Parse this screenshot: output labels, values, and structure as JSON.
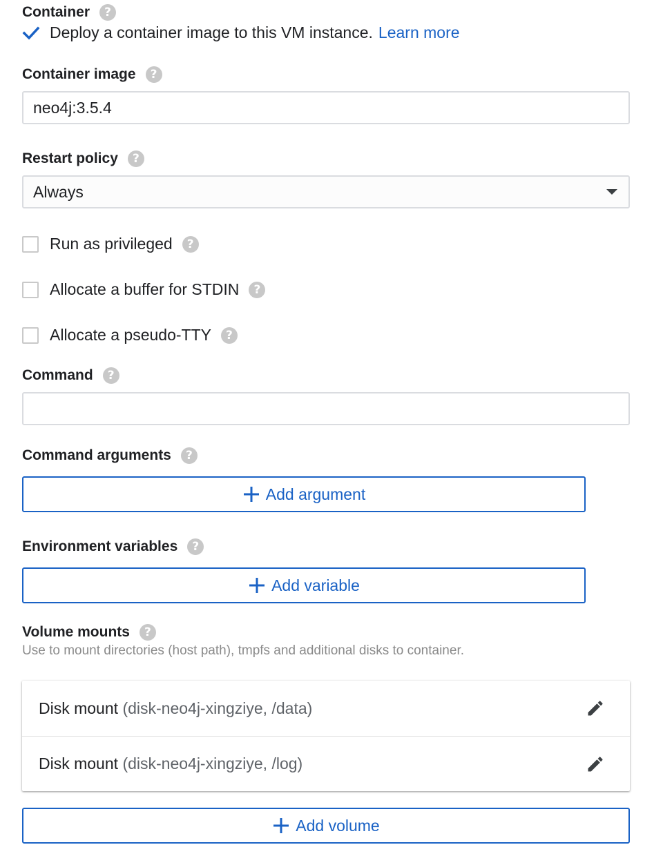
{
  "container": {
    "label": "Container",
    "deploy_checked": true,
    "deploy_text": "Deploy a container image to this VM instance.",
    "learn_more": "Learn more"
  },
  "container_image": {
    "label": "Container image",
    "value": "neo4j:3.5.4"
  },
  "restart_policy": {
    "label": "Restart policy",
    "selected": "Always"
  },
  "options": {
    "privileged": "Run as privileged",
    "stdin": "Allocate a buffer for STDIN",
    "tty": "Allocate a pseudo-TTY"
  },
  "command": {
    "label": "Command",
    "value": ""
  },
  "command_arguments": {
    "label": "Command arguments",
    "button": "Add argument"
  },
  "env_vars": {
    "label": "Environment variables",
    "button": "Add variable"
  },
  "volume_mounts": {
    "label": "Volume mounts",
    "description": "Use to mount directories (host path), tmpfs and additional disks to container.",
    "items": [
      {
        "type": "Disk mount",
        "detail": "(disk-neo4j-xingziye, /data)"
      },
      {
        "type": "Disk mount",
        "detail": "(disk-neo4j-xingziye, /log)"
      }
    ],
    "button": "Add volume"
  },
  "help_glyph": "?",
  "colors": {
    "accent": "#1a62c5",
    "help_circle": "#c8c8c8",
    "border": "#dadce0"
  }
}
